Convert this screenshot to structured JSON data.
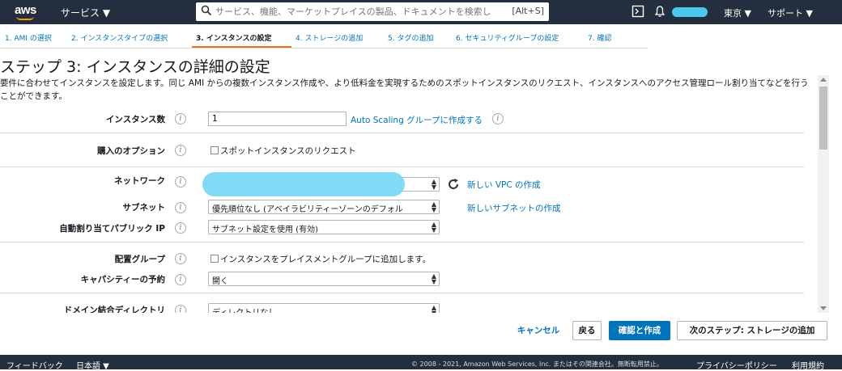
{
  "colors": {
    "topbar": "#232f3e",
    "accent": "#ec7211",
    "link": "#0073bb",
    "primary_button": "#0073bb"
  },
  "topbar": {
    "logo": "aws",
    "services_label": "サービス ▼",
    "search_placeholder": "サービス、機能、マーケットプレイスの製品、ドキュメントを検索し",
    "search_shortcut": "[Alt+S]",
    "region": "東京 ▼",
    "support": "サポート ▼",
    "icons": [
      "cloudshell-icon",
      "bell-icon"
    ]
  },
  "steps": [
    {
      "label": "1. AMI の選択"
    },
    {
      "label": "2. インスタンスタイプの選択"
    },
    {
      "label": "3. インスタンスの設定"
    },
    {
      "label": "4. ストレージの追加"
    },
    {
      "label": "5. タグの追加"
    },
    {
      "label": "6. セキュリティグループの設定"
    },
    {
      "label": "7. 確認"
    }
  ],
  "page": {
    "title": "ステップ 3: インスタンスの詳細の設定",
    "description": "要件に合わせてインスタンスを設定します。同じ AMI からの複数インスタンス作成や、より低料金を実現するためのスポットインスタンスのリクエスト、インスタンスへのアクセス管理ロール割り当てなどを行うことができます。"
  },
  "form": {
    "instance_count": {
      "label": "インスタンス数",
      "value": "1",
      "link": "Auto Scaling グループに作成する"
    },
    "purchase_option": {
      "label": "購入のオプション",
      "checkbox": "スポットインスタンスのリクエスト"
    },
    "network": {
      "label": "ネットワーク",
      "link": "新しい VPC の作成"
    },
    "subnet": {
      "label": "サブネット",
      "value": "優先順位なし (アベイラビリティーゾーンのデフォル",
      "link": "新しいサブネットの作成"
    },
    "public_ip": {
      "label": "自動割り当てパブリック IP",
      "value": "サブネット設定を使用 (有効)"
    },
    "placement_group": {
      "label": "配置グループ",
      "checkbox": "インスタンスをプレイスメントグループに追加します。"
    },
    "capacity": {
      "label": "キャパシティーの予約",
      "value": "開く"
    },
    "domain": {
      "label": "ドメイン結合ディレクトリ",
      "value": "ディレクトリなし"
    }
  },
  "buttons": {
    "cancel": "キャンセル",
    "back": "戻る",
    "launch": "確認と作成",
    "next": "次のステップ: ストレージの追加"
  },
  "footer": {
    "feedback": "フィードバック",
    "language": "日本語 ▼",
    "copyright": "© 2008 - 2021, Amazon Web Services, Inc. またはその関連会社。無断転用禁止。",
    "privacy": "プライバシーポリシー",
    "terms": "利用規約"
  }
}
